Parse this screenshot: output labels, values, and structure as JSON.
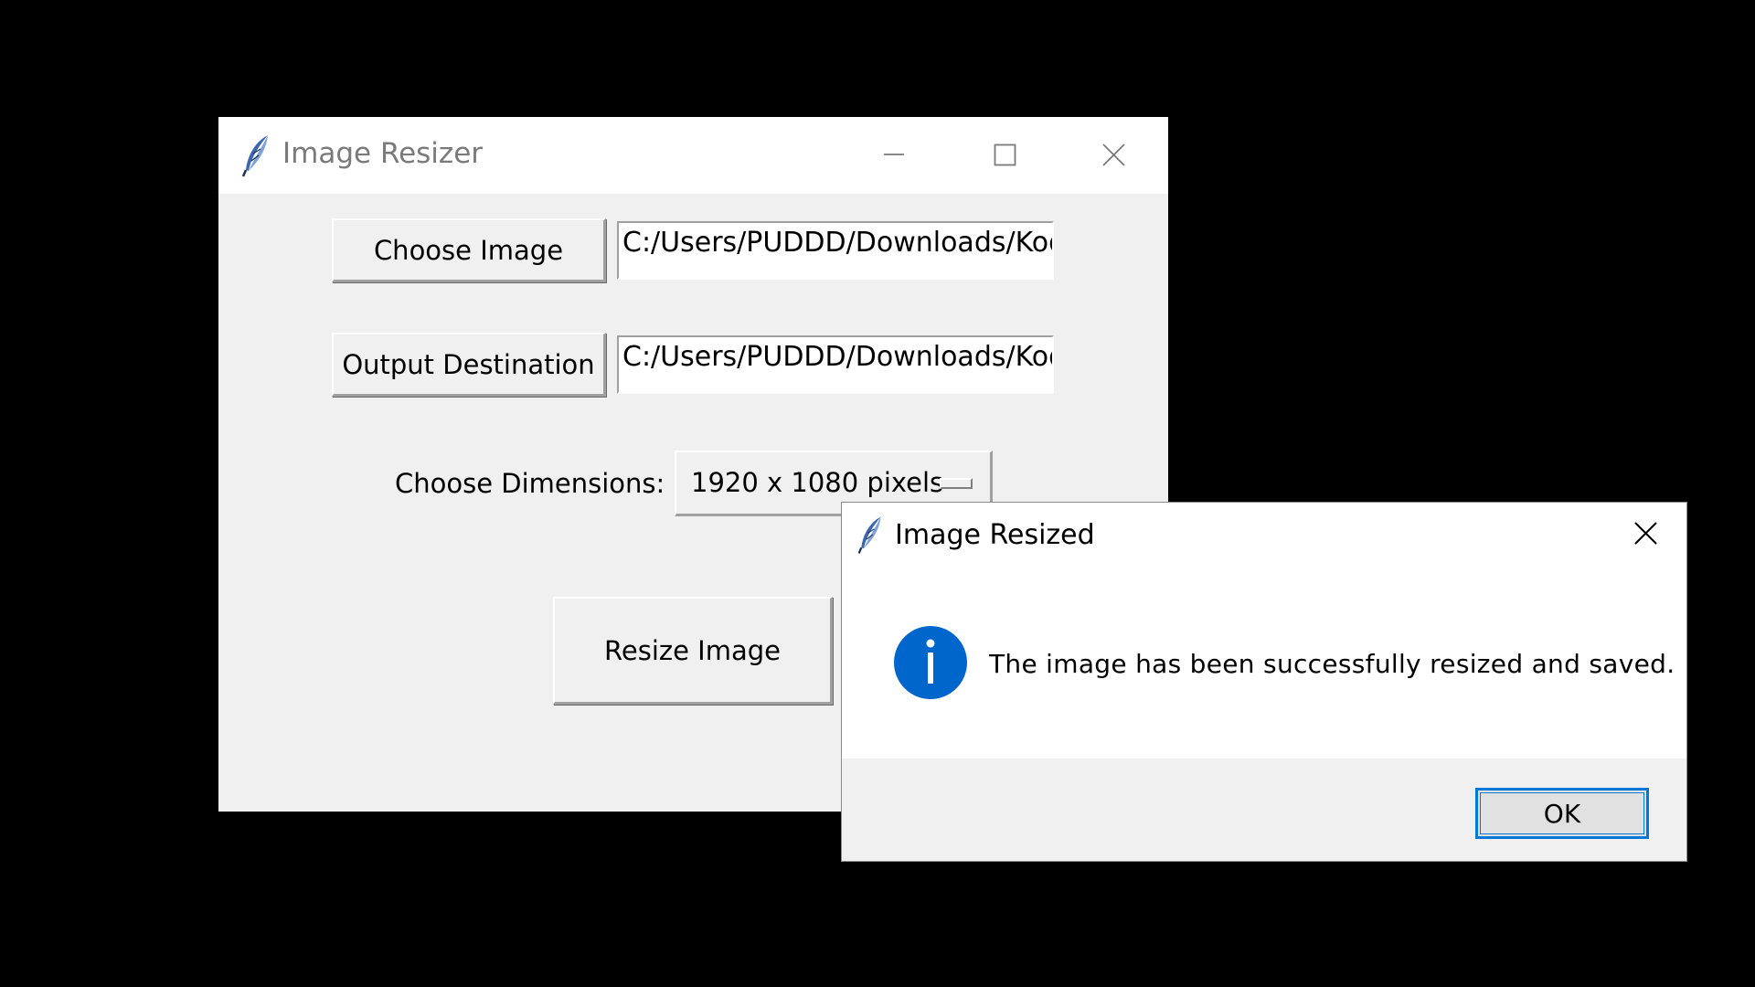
{
  "main_window": {
    "title": "Image Resizer",
    "title_icon": "tk-feather-icon",
    "controls": {
      "minimize_icon": "minimize-icon",
      "maximize_icon": "maximize-icon",
      "close_icon": "close-icon"
    },
    "choose_image_button": "Choose Image",
    "image_path_value": "C:/Users/PUDDD/Downloads/Kodi",
    "output_destination_button": "Output Destination",
    "output_path_value": "C:/Users/PUDDD/Downloads/Kodi",
    "dimensions_label": "Choose Dimensions:",
    "dimensions_selected": "1920 x 1080 pixels",
    "resize_button": "Resize Image"
  },
  "dialog": {
    "title": "Image Resized",
    "title_icon": "tk-feather-icon",
    "close_icon": "close-icon",
    "info_icon": "info-icon",
    "message": "The image has been successfully resized and saved.",
    "ok_button": "OK"
  },
  "colors": {
    "background": "#000000",
    "window_body": "#f0f0f0",
    "titlebar": "#ffffff",
    "title_text_inactive": "#7a7a7a",
    "accent": "#0078d7",
    "info_icon_fill": "#0066cc"
  }
}
